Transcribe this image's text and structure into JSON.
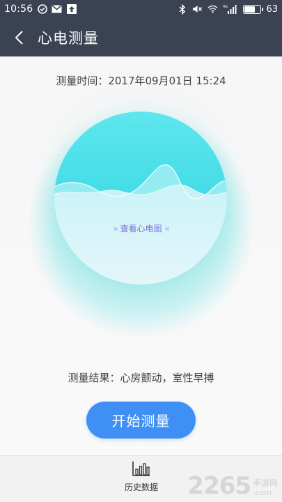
{
  "status_bar": {
    "time": "10:56",
    "battery": "63",
    "network": "4G"
  },
  "app_bar": {
    "title": "心电测量"
  },
  "main": {
    "measure_time": "测量时间：2017年09月01日 15:24",
    "view_ecg_label": "查看心电图",
    "view_ecg_left_arrows": "»",
    "view_ecg_right_arrows": "«",
    "result_text": "测量结果：心房颤动，室性早搏",
    "start_button_label": "开始测量"
  },
  "bottom_nav": {
    "history_label": "历史数据"
  },
  "watermark": {
    "number": "2265",
    "top_text": "手游网",
    "bottom_text": ".com"
  },
  "colors": {
    "header": "#3b4251",
    "accent": "#3f8ff4",
    "circle_teal": "#35d8e6",
    "ecg_link": "#7d6fd0"
  }
}
